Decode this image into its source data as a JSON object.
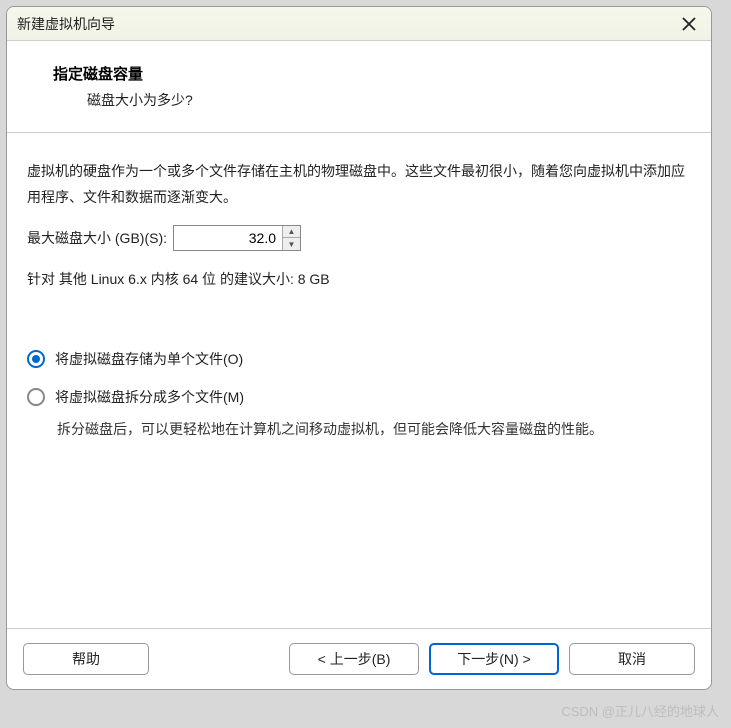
{
  "titlebar": {
    "title": "新建虚拟机向导"
  },
  "header": {
    "title": "指定磁盘容量",
    "subtitle": "磁盘大小为多少?"
  },
  "content": {
    "description": "虚拟机的硬盘作为一个或多个文件存储在主机的物理磁盘中。这些文件最初很小，随着您向虚拟机中添加应用程序、文件和数据而逐渐变大。",
    "size_label": "最大磁盘大小 (GB)(S):",
    "size_value": "32.0",
    "recommend": "针对 其他 Linux 6.x 内核 64 位 的建议大小: 8 GB",
    "radio_single": "将虚拟磁盘存储为单个文件(O)",
    "radio_split": "将虚拟磁盘拆分成多个文件(M)",
    "split_note": "拆分磁盘后，可以更轻松地在计算机之间移动虚拟机，但可能会降低大容量磁盘的性能。"
  },
  "footer": {
    "help": "帮助",
    "prev": "< 上一步(B)",
    "next": "下一步(N) >",
    "cancel": "取消"
  },
  "watermark": "CSDN @正儿八经的地球人"
}
